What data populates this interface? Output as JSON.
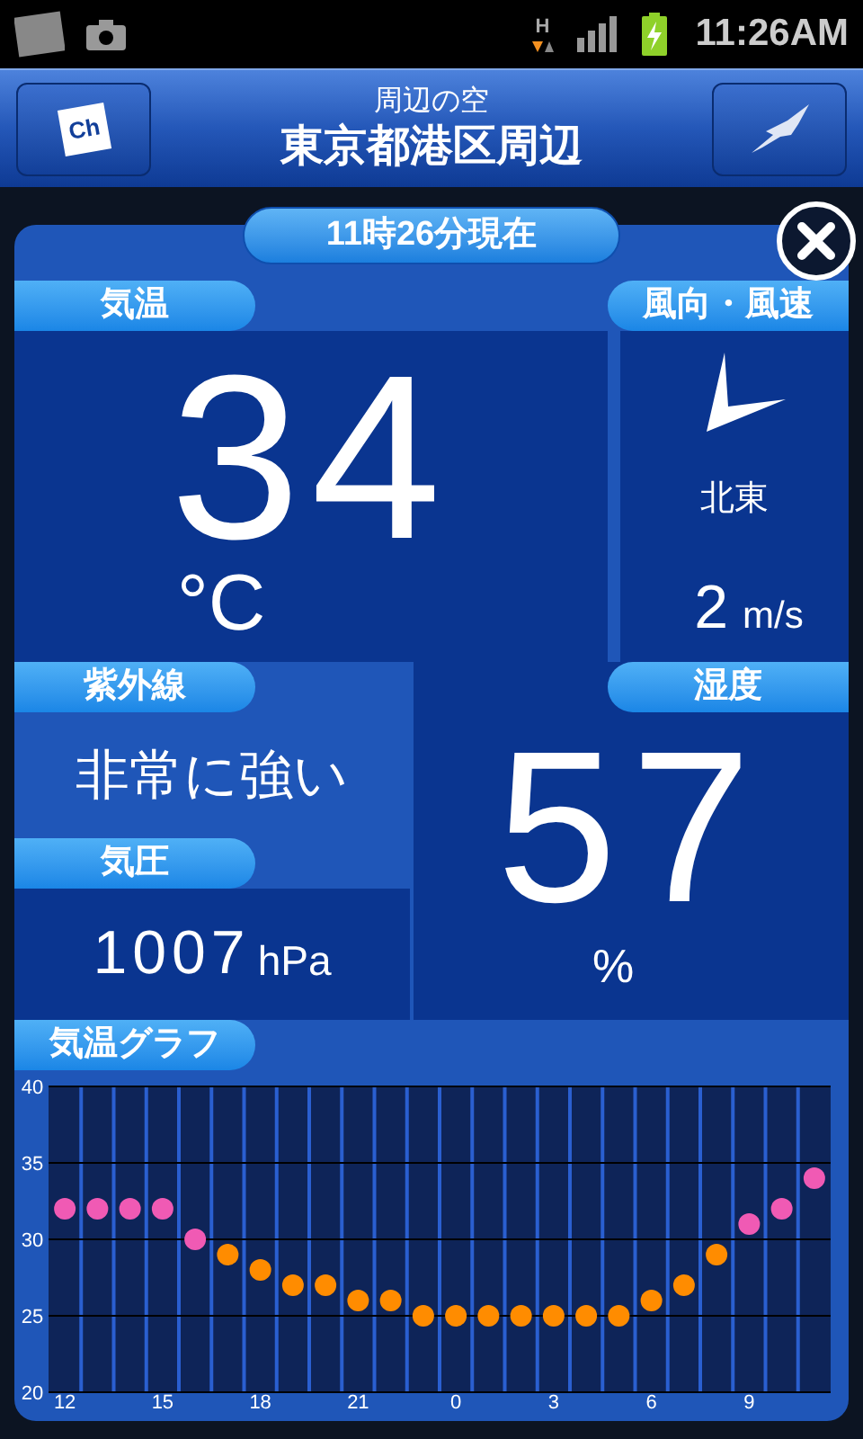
{
  "status_bar": {
    "network_type": "H",
    "time": "11:26AM"
  },
  "header": {
    "left_button": "Ch",
    "subtitle": "周辺の空",
    "title": "東京都港区周辺"
  },
  "timestamp": "11時26分現在",
  "temperature": {
    "label": "気温",
    "value": "34",
    "unit": "°C"
  },
  "wind": {
    "label": "風向・風速",
    "direction": "北東",
    "speed": "2",
    "unit": "m/s"
  },
  "uv": {
    "label": "紫外線",
    "value": "非常に強い"
  },
  "pressure": {
    "label": "気圧",
    "value": "1007",
    "unit": "hPa"
  },
  "humidity": {
    "label": "湿度",
    "value": "57",
    "unit": "%"
  },
  "graph": {
    "label": "気温グラフ",
    "chart_data": {
      "type": "scatter",
      "categories": [
        "12",
        null,
        null,
        "15",
        null,
        null,
        "18",
        null,
        null,
        "21",
        null,
        null,
        "0",
        null,
        null,
        "3",
        null,
        null,
        "6",
        null,
        null,
        "9",
        null,
        null
      ],
      "series": [
        {
          "color": "#f05ab4",
          "values": [
            32,
            32,
            32,
            32,
            30,
            null,
            null,
            null,
            null,
            null,
            null,
            null,
            null,
            null,
            null,
            null,
            null,
            null,
            null,
            null,
            null,
            31,
            32,
            34
          ]
        },
        {
          "color": "#ff8c00",
          "values": [
            null,
            null,
            null,
            null,
            null,
            29,
            28,
            27,
            27,
            26,
            26,
            25,
            25,
            25,
            25,
            25,
            25,
            25,
            26,
            27,
            29,
            null,
            null,
            null
          ]
        }
      ],
      "grid": true,
      "ylim": [
        20,
        40
      ],
      "yticks": [
        20,
        25,
        30,
        35,
        40
      ]
    }
  }
}
